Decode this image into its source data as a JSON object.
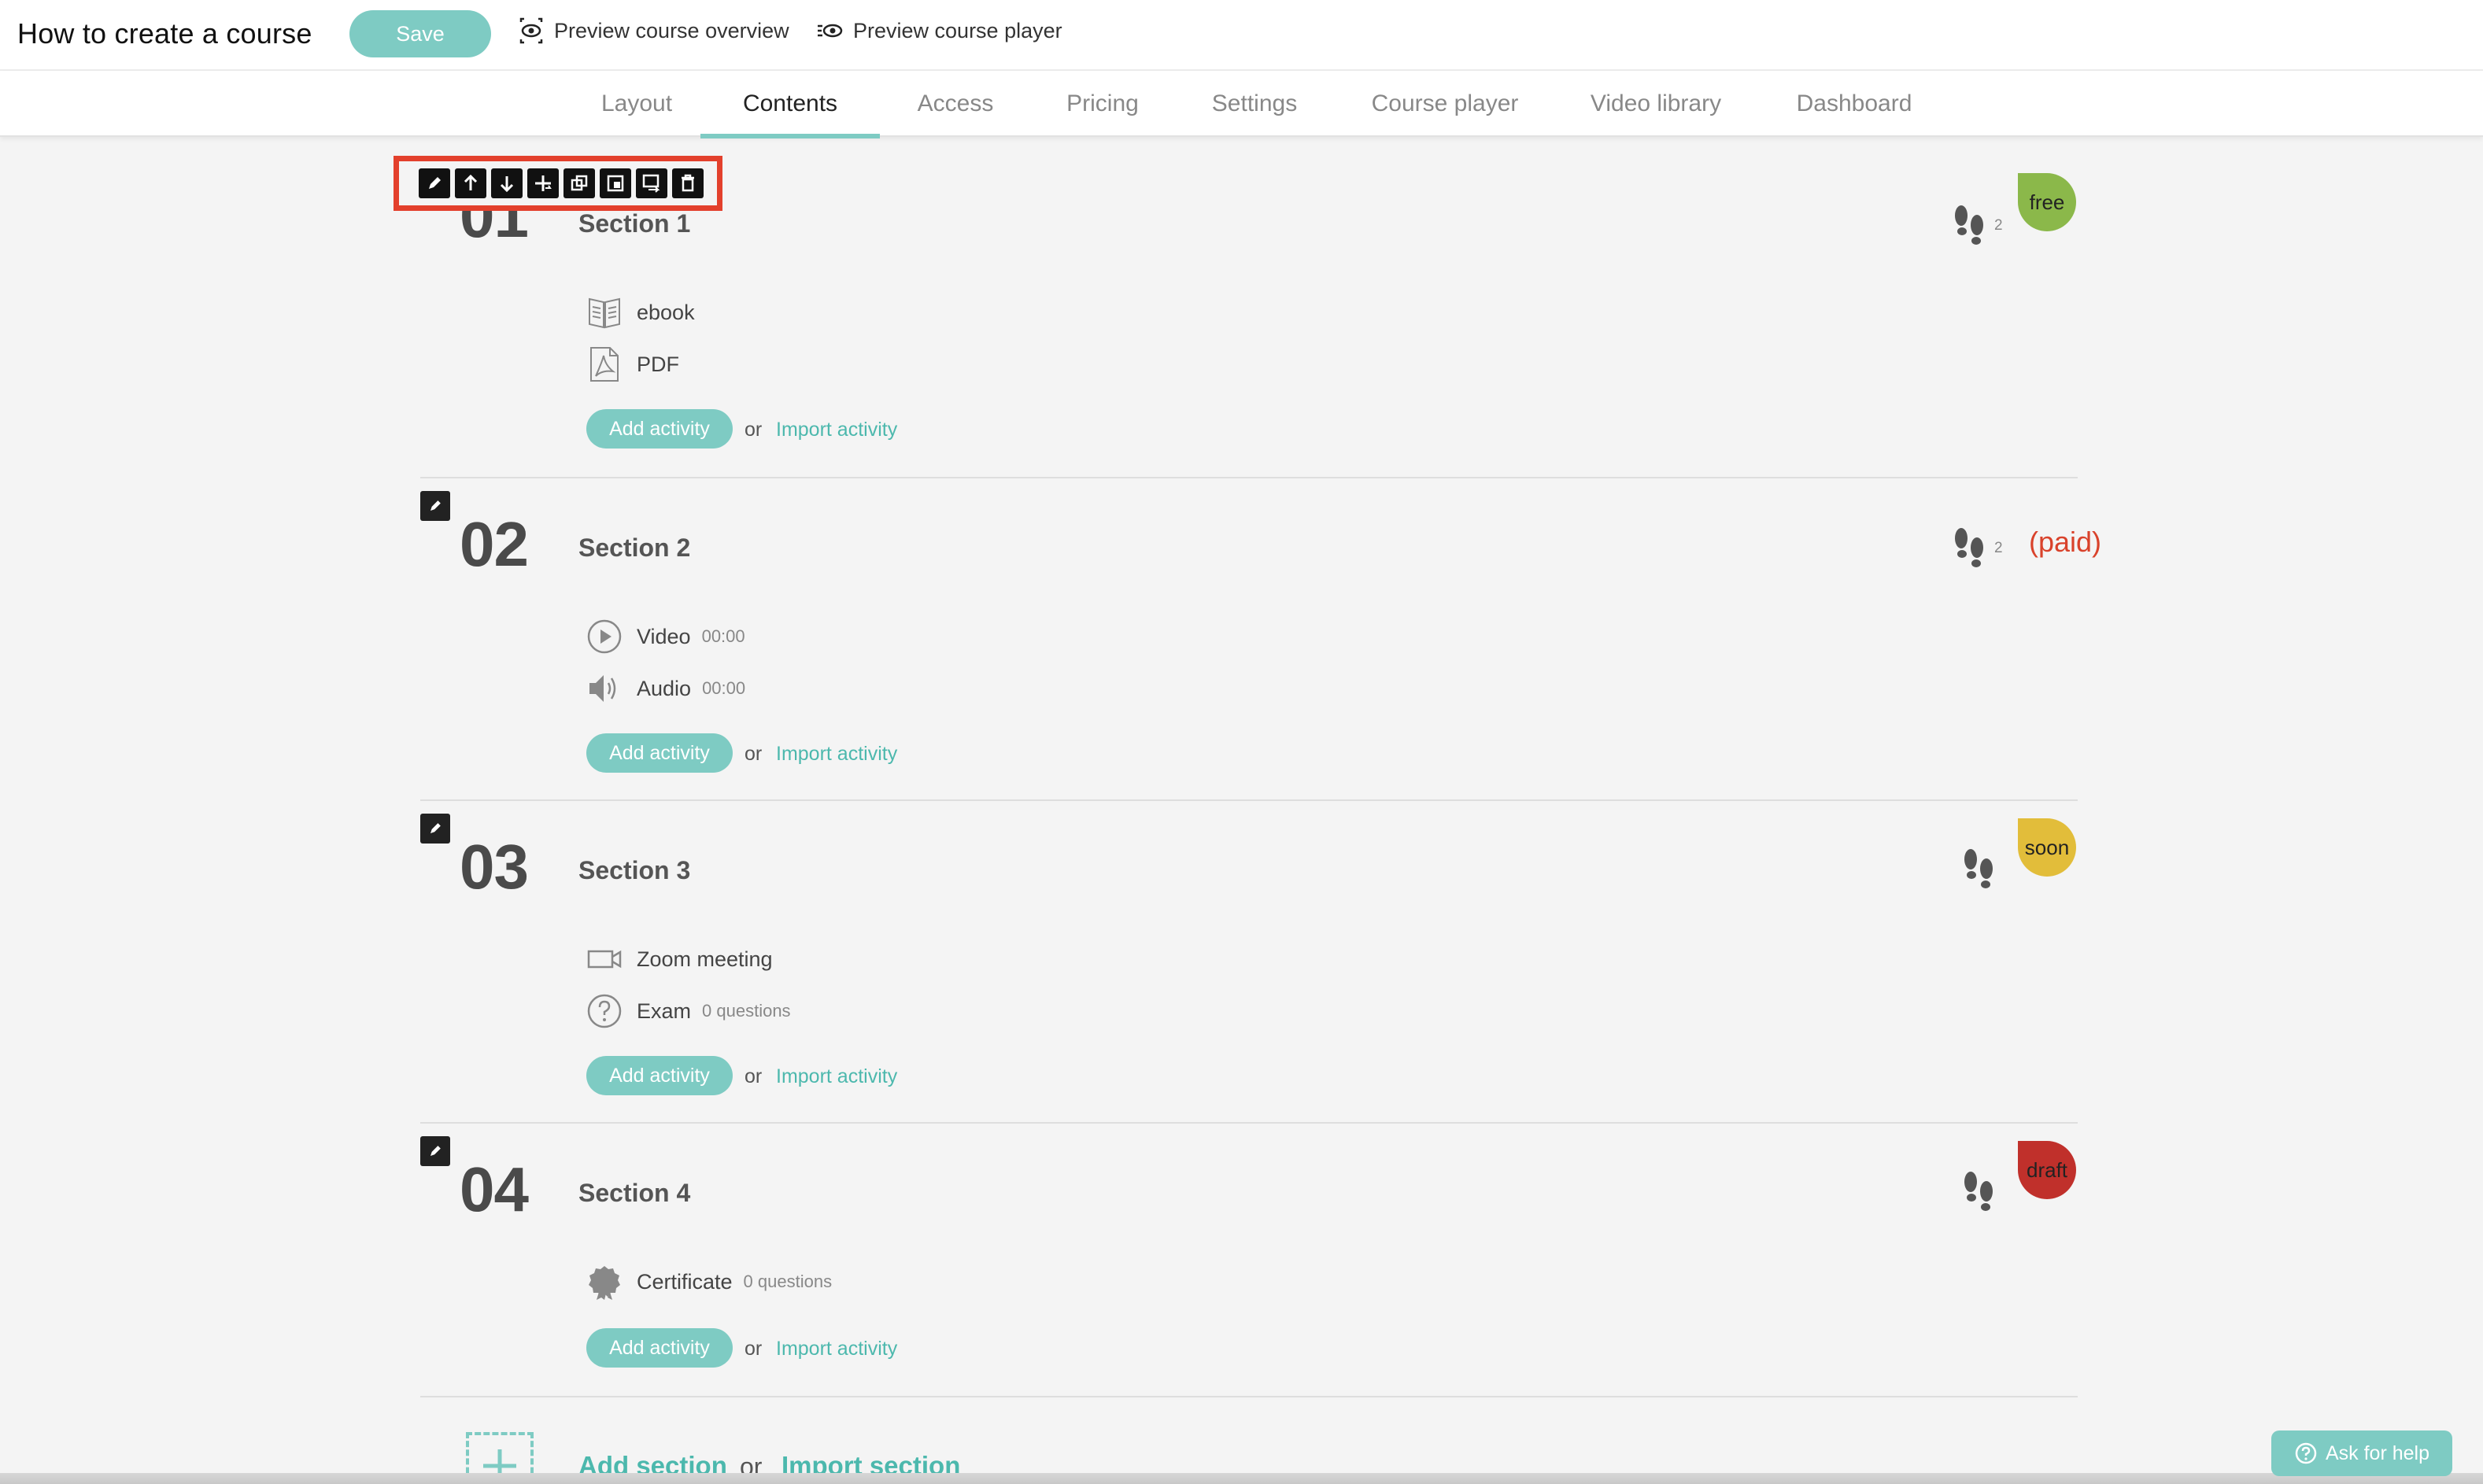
{
  "header": {
    "title": "How to create a course",
    "save_label": "Save",
    "preview_overview_label": "Preview course overview",
    "preview_player_label": "Preview course player"
  },
  "tabs": [
    {
      "label": "Layout",
      "active": false
    },
    {
      "label": "Contents",
      "active": true
    },
    {
      "label": "Access",
      "active": false
    },
    {
      "label": "Pricing",
      "active": false
    },
    {
      "label": "Settings",
      "active": false
    },
    {
      "label": "Course player",
      "active": false
    },
    {
      "label": "Video library",
      "active": false
    },
    {
      "label": "Dashboard",
      "active": false
    }
  ],
  "toolbar": {
    "highlight_color": "#e3402c",
    "tools": [
      "edit-icon",
      "move-up-icon",
      "move-down-icon",
      "add-icon",
      "duplicate-icon",
      "copy-icon",
      "move-to-icon",
      "delete-icon"
    ]
  },
  "common": {
    "add_activity_label": "Add activity",
    "or_label": "or",
    "import_activity_label": "Import activity"
  },
  "sections": [
    {
      "number": "01",
      "title": "Section 1",
      "visit_count": "2",
      "badge": {
        "text": "free",
        "color": "#8bb84a"
      },
      "activities": [
        {
          "icon": "ebook-icon",
          "label": "ebook",
          "meta": ""
        },
        {
          "icon": "pdf-icon",
          "label": "PDF",
          "meta": ""
        }
      ]
    },
    {
      "number": "02",
      "title": "Section 2",
      "visit_count": "2",
      "paid_label": "(paid)",
      "activities": [
        {
          "icon": "play-icon",
          "label": "Video",
          "meta": "00:00"
        },
        {
          "icon": "speaker-icon",
          "label": "Audio",
          "meta": "00:00"
        }
      ]
    },
    {
      "number": "03",
      "title": "Section 3",
      "visit_count": "",
      "badge": {
        "text": "soon",
        "color": "#e2bd3a"
      },
      "activities": [
        {
          "icon": "video-camera-icon",
          "label": "Zoom meeting",
          "meta": ""
        },
        {
          "icon": "question-icon",
          "label": "Exam",
          "meta": "0 questions"
        }
      ]
    },
    {
      "number": "04",
      "title": "Section 4",
      "visit_count": "",
      "badge": {
        "text": "draft",
        "color": "#c0302b"
      },
      "activities": [
        {
          "icon": "certificate-icon",
          "label": "Certificate",
          "meta": "0 questions"
        }
      ]
    }
  ],
  "footer": {
    "add_section_label": "Add section",
    "or_label": "or",
    "import_section_label": "Import section",
    "help_label": "Ask for help"
  },
  "colors": {
    "accent": "#7ecbc3",
    "accent_text": "#4cb8ad",
    "background": "#f4f4f4"
  }
}
